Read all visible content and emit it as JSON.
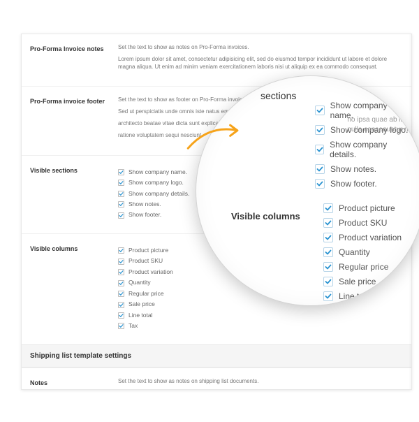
{
  "colors": {
    "accent": "#f6a31a",
    "check": "#2993d1"
  },
  "lorem56": "Set the text to show as notes on Pro-Forma invoices.",
  "loremlong": "Lorem ipsum dolor sit amet, consectetur adipisicing elit, sed do eiusmod tempor incididunt ut labore et dolore magna aliqua. Ut enim ad minim veniam exercitationem laboris nisi ut aliquip ex ea commodo consequat.",
  "footer_desc1": "Set the text to show as footer on Pro-Forma invoice",
  "footer_desc2": "Sed ut perspiciatis unde omnis iste natus error",
  "footer_desc3": "architecto beatae vitae dicta sunt explicabo",
  "footer_desc4": "ratione voluptatem sequi nesciunt.",
  "sections_label_small": "sections",
  "labels": {
    "notes": "Pro-Forma Invoice notes",
    "footer": "Pro-Forma invoice footer",
    "visible_sections": "Visible sections",
    "visible_columns": "Visible columns",
    "ship_head": "Shipping list template settings",
    "ship_notes": "Notes",
    "ship_desc": "Set the text to show as notes on shipping list documents."
  },
  "visible_sections": [
    "Show company name.",
    "Show company logo.",
    "Show company details.",
    "Show notes.",
    "Show footer."
  ],
  "visible_columns": [
    "Product picture",
    "Product SKU",
    "Product variation",
    "Quantity",
    "Regular price",
    "Sale price",
    "Line total",
    "Tax"
  ],
  "zoom": {
    "footer_right_trail": "no ipsa quae ab illo invent",
    "footer_right_trail2": "nulla consequatur mag",
    "visible_columns_label": "Visible columns"
  }
}
